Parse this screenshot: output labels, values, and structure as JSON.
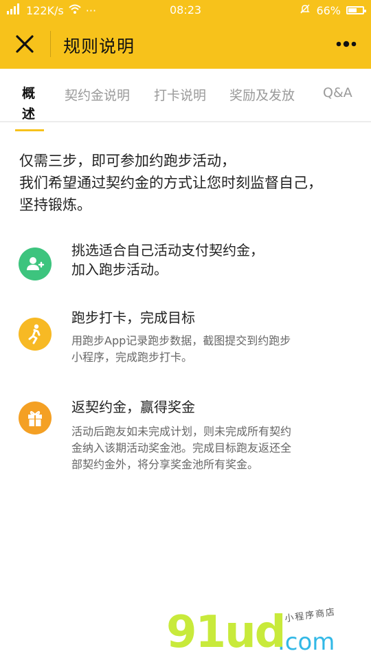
{
  "status_bar": {
    "signal": "4G",
    "speed": "122K/s",
    "more": "···",
    "time": "08:23",
    "battery": "66%",
    "battery_level": 0.66
  },
  "header": {
    "title": "规则说明"
  },
  "tabs": [
    {
      "label": "概述",
      "active": true
    },
    {
      "label": "契约金说明",
      "active": false
    },
    {
      "label": "打卡说明",
      "active": false
    },
    {
      "label": "奖励及发放",
      "active": false
    },
    {
      "label": "Q&A",
      "active": false
    }
  ],
  "intro": {
    "line1": "仅需三步，即可参加约跑步活动，",
    "line2": "我们希望通过契约金的方式让您时刻监督自己，",
    "line3": "坚持锻炼。"
  },
  "steps": [
    {
      "icon": "add-user-icon",
      "color": "#3dc47e",
      "title_line1": "挑选适合自己活动支付契约金，",
      "title_line2": "加入跑步活动。",
      "desc_line1": "",
      "desc_line2": "",
      "desc_line3": ""
    },
    {
      "icon": "runner-icon",
      "color": "#f7b924",
      "title_line1": "跑步打卡，完成目标",
      "title_line2": "",
      "desc_line1": "用跑步App记录跑步数据，截图提交到约跑步",
      "desc_line2": "小程序，完成跑步打卡。",
      "desc_line3": ""
    },
    {
      "icon": "gift-icon",
      "color": "#f4a024",
      "title_line1": "返契约金，赢得奖金",
      "title_line2": "",
      "desc_line1": "活动后跑友如未完成计划，则未完成所有契约",
      "desc_line2": "金纳入该期活动奖金池。完成目标跑友返还全",
      "desc_line3": "部契约金外，将分享奖金池所有奖金。"
    }
  ],
  "watermark": {
    "brand": "91ud",
    "domain": ".com",
    "tagline": "小程序商店"
  },
  "colors": {
    "accent": "#f7c21b",
    "tab_inactive": "#9a9a9a"
  }
}
